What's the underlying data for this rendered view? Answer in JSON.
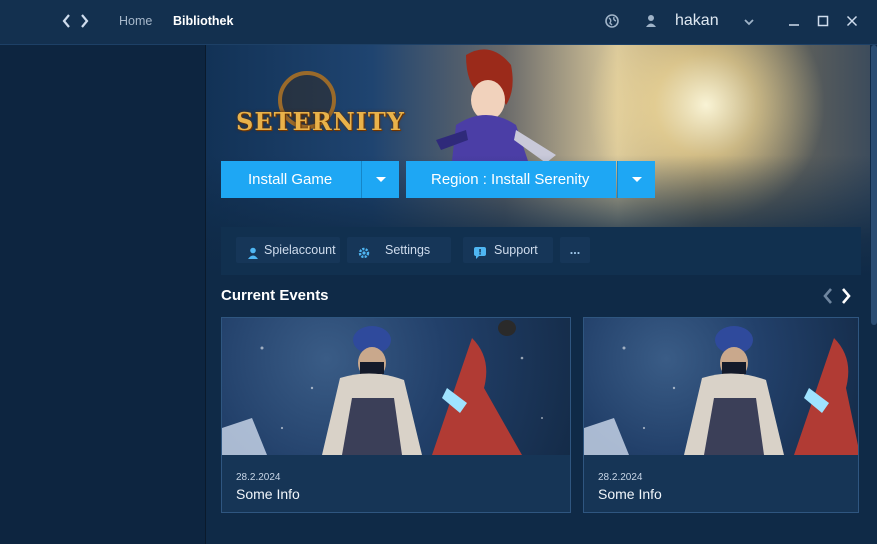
{
  "titlebar": {
    "nav": {
      "back_icon": "chevron-left-icon",
      "forward_icon": "chevron-right-icon"
    },
    "tabs": [
      {
        "label": "Home",
        "active": false
      },
      {
        "label": "Bibliothek",
        "active": true
      }
    ],
    "globe_icon": "globe-icon",
    "user_icon": "user-icon",
    "username": "hakan",
    "user_menu_icon": "chevron-down-icon",
    "window_controls": [
      "minimize-icon",
      "maximize-icon",
      "close-icon"
    ]
  },
  "game": {
    "logo_text": "SETERNITY",
    "install_button": "Install Game",
    "region_button": "Region : Install Serenity"
  },
  "links": [
    {
      "label": "Spielaccount",
      "icon": "user-icon"
    },
    {
      "label": "Settings",
      "icon": "gear-icon"
    },
    {
      "label": "Support",
      "icon": "chat-icon"
    },
    {
      "label": "...",
      "icon": "more-icon"
    }
  ],
  "events": {
    "title": "Current Events",
    "cards": [
      {
        "date": "28.2.2024",
        "title": "Some Info"
      },
      {
        "date": "28.2.2024",
        "title": "Some Info"
      }
    ]
  },
  "colors": {
    "accent": "#1ea7f4",
    "titlebar": "#13304f",
    "background": "#0f2a47"
  }
}
